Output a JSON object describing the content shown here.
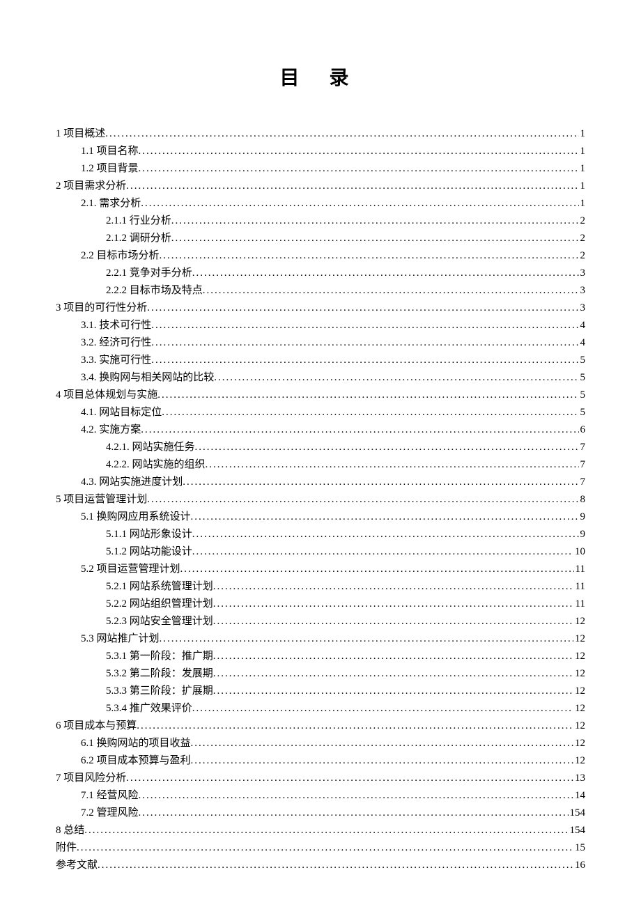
{
  "title": "目 录",
  "entries": [
    {
      "label": "1 项目概述",
      "page": "1",
      "level": 0
    },
    {
      "label": "1.1 项目名称",
      "page": "1",
      "level": 1
    },
    {
      "label": "1.2 项目背景",
      "page": "1",
      "level": 1
    },
    {
      "label": "2 项目需求分析",
      "page": "1",
      "level": 0
    },
    {
      "label": "2.1. 需求分析",
      "page": "1",
      "level": 1
    },
    {
      "label": "2.1.1 行业分析",
      "page": "2",
      "level": 2
    },
    {
      "label": "2.1.2 调研分析",
      "page": "2",
      "level": 2
    },
    {
      "label": "2.2 目标市场分析",
      "page": "2",
      "level": 1
    },
    {
      "label": "2.2.1 竞争对手分析",
      "page": "3",
      "level": 2
    },
    {
      "label": "2.2.2 目标市场及特点",
      "page": "3",
      "level": 2
    },
    {
      "label": "3 项目的可行性分析",
      "page": "3",
      "level": 0
    },
    {
      "label": "3.1. 技术可行性",
      "page": "4",
      "level": 1
    },
    {
      "label": "3.2. 经济可行性",
      "page": "4",
      "level": 1
    },
    {
      "label": "3.3. 实施可行性",
      "page": "5",
      "level": 1
    },
    {
      "label": "3.4. 换购网与相关网站的比较",
      "page": "5",
      "level": 1
    },
    {
      "label": "4 项目总体规划与实施",
      "page": "5",
      "level": 0
    },
    {
      "label": "4.1. 网站目标定位",
      "page": "5",
      "level": 1
    },
    {
      "label": "4.2. 实施方案",
      "page": "6",
      "level": 1
    },
    {
      "label": "4.2.1. 网站实施任务",
      "page": "7",
      "level": 2
    },
    {
      "label": "4.2.2. 网站实施的组织",
      "page": "7",
      "level": 2
    },
    {
      "label": "4.3. 网站实施进度计划",
      "page": "7",
      "level": 1
    },
    {
      "label": "5 项目运营管理计划",
      "page": "8",
      "level": 0
    },
    {
      "label": "5.1 换购网应用系统设计",
      "page": "9",
      "level": 1
    },
    {
      "label": "5.1.1 网站形象设计",
      "page": "9",
      "level": 2
    },
    {
      "label": "5.1.2 网站功能设计",
      "page": "10",
      "level": 2
    },
    {
      "label": "5.2 项目运营管理计划",
      "page": "11",
      "level": 1
    },
    {
      "label": "5.2.1 网站系统管理计划",
      "page": "11",
      "level": 2
    },
    {
      "label": "5.2.2 网站组织管理计划",
      "page": "11",
      "level": 2
    },
    {
      "label": "5.2.3 网站安全管理计划",
      "page": "12",
      "level": 2
    },
    {
      "label": "5.3 网站推广计划",
      "page": "12",
      "level": 1
    },
    {
      "label": "5.3.1 第一阶段：推广期",
      "page": "12",
      "level": 2
    },
    {
      "label": "5.3.2 第二阶段：发展期",
      "page": "12",
      "level": 2
    },
    {
      "label": "5.3.3 第三阶段：扩展期",
      "page": "12",
      "level": 2
    },
    {
      "label": "5.3.4 推广效果评价",
      "page": "12",
      "level": 2
    },
    {
      "label": "6 项目成本与预算",
      "page": "12",
      "level": 0
    },
    {
      "label": "6.1 换购网站的项目收益",
      "page": "12",
      "level": 1
    },
    {
      "label": "6.2 项目成本预算与盈利",
      "page": "12",
      "level": 1
    },
    {
      "label": "7 项目风险分析",
      "page": "13",
      "level": 0
    },
    {
      "label": "7.1 经营风险",
      "page": "14",
      "level": 1
    },
    {
      "label": "7.2 管理风险",
      "page": "154",
      "level": 1
    },
    {
      "label": "8 总结",
      "page": "154",
      "level": 0
    },
    {
      "label": "附件",
      "page": "15",
      "level": 0
    },
    {
      "label": "参考文献",
      "page": "16",
      "level": 0
    }
  ]
}
